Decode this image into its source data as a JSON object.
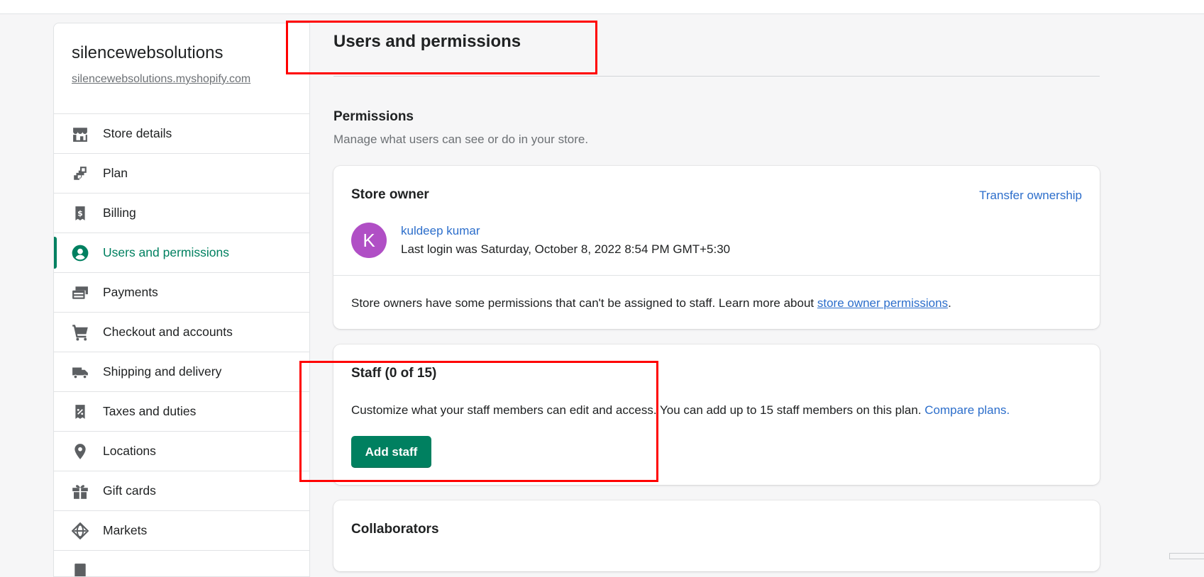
{
  "store": {
    "name": "silencewebsolutions",
    "url": "silencewebsolutions.myshopify.com"
  },
  "sidebar": {
    "items": [
      {
        "label": "Store details",
        "icon": "store-icon",
        "active": false
      },
      {
        "label": "Plan",
        "icon": "plan-icon",
        "active": false
      },
      {
        "label": "Billing",
        "icon": "billing-icon",
        "active": false
      },
      {
        "label": "Users and permissions",
        "icon": "user-icon",
        "active": true
      },
      {
        "label": "Payments",
        "icon": "payments-icon",
        "active": false
      },
      {
        "label": "Checkout and accounts",
        "icon": "cart-icon",
        "active": false
      },
      {
        "label": "Shipping and delivery",
        "icon": "truck-icon",
        "active": false
      },
      {
        "label": "Taxes and duties",
        "icon": "tax-icon",
        "active": false
      },
      {
        "label": "Locations",
        "icon": "location-icon",
        "active": false
      },
      {
        "label": "Gift cards",
        "icon": "gift-icon",
        "active": false
      },
      {
        "label": "Markets",
        "icon": "globe-icon",
        "active": false
      }
    ]
  },
  "page": {
    "title": "Users and permissions"
  },
  "permissions": {
    "title": "Permissions",
    "description": "Manage what users can see or do in your store."
  },
  "owner": {
    "title": "Store owner",
    "transfer_label": "Transfer ownership",
    "avatar_initial": "K",
    "name": "kuldeep kumar",
    "last_login": "Last login was Saturday, October 8, 2022 8:54 PM GMT+5:30",
    "note_text": "Store owners have some permissions that can't be assigned to staff. Learn more about ",
    "note_link": "store owner permissions",
    "note_end": "."
  },
  "staff": {
    "title": "Staff (0 of 15)",
    "description": "Customize what your staff members can edit and access. You can add up to 15 staff members on this plan. ",
    "compare_link": "Compare plans.",
    "add_button": "Add staff"
  },
  "collaborators": {
    "title": "Collaborators"
  },
  "colors": {
    "accent": "#008060",
    "link": "#2c6ecb",
    "avatar": "#b04fc5",
    "highlight": "#ff0000"
  }
}
